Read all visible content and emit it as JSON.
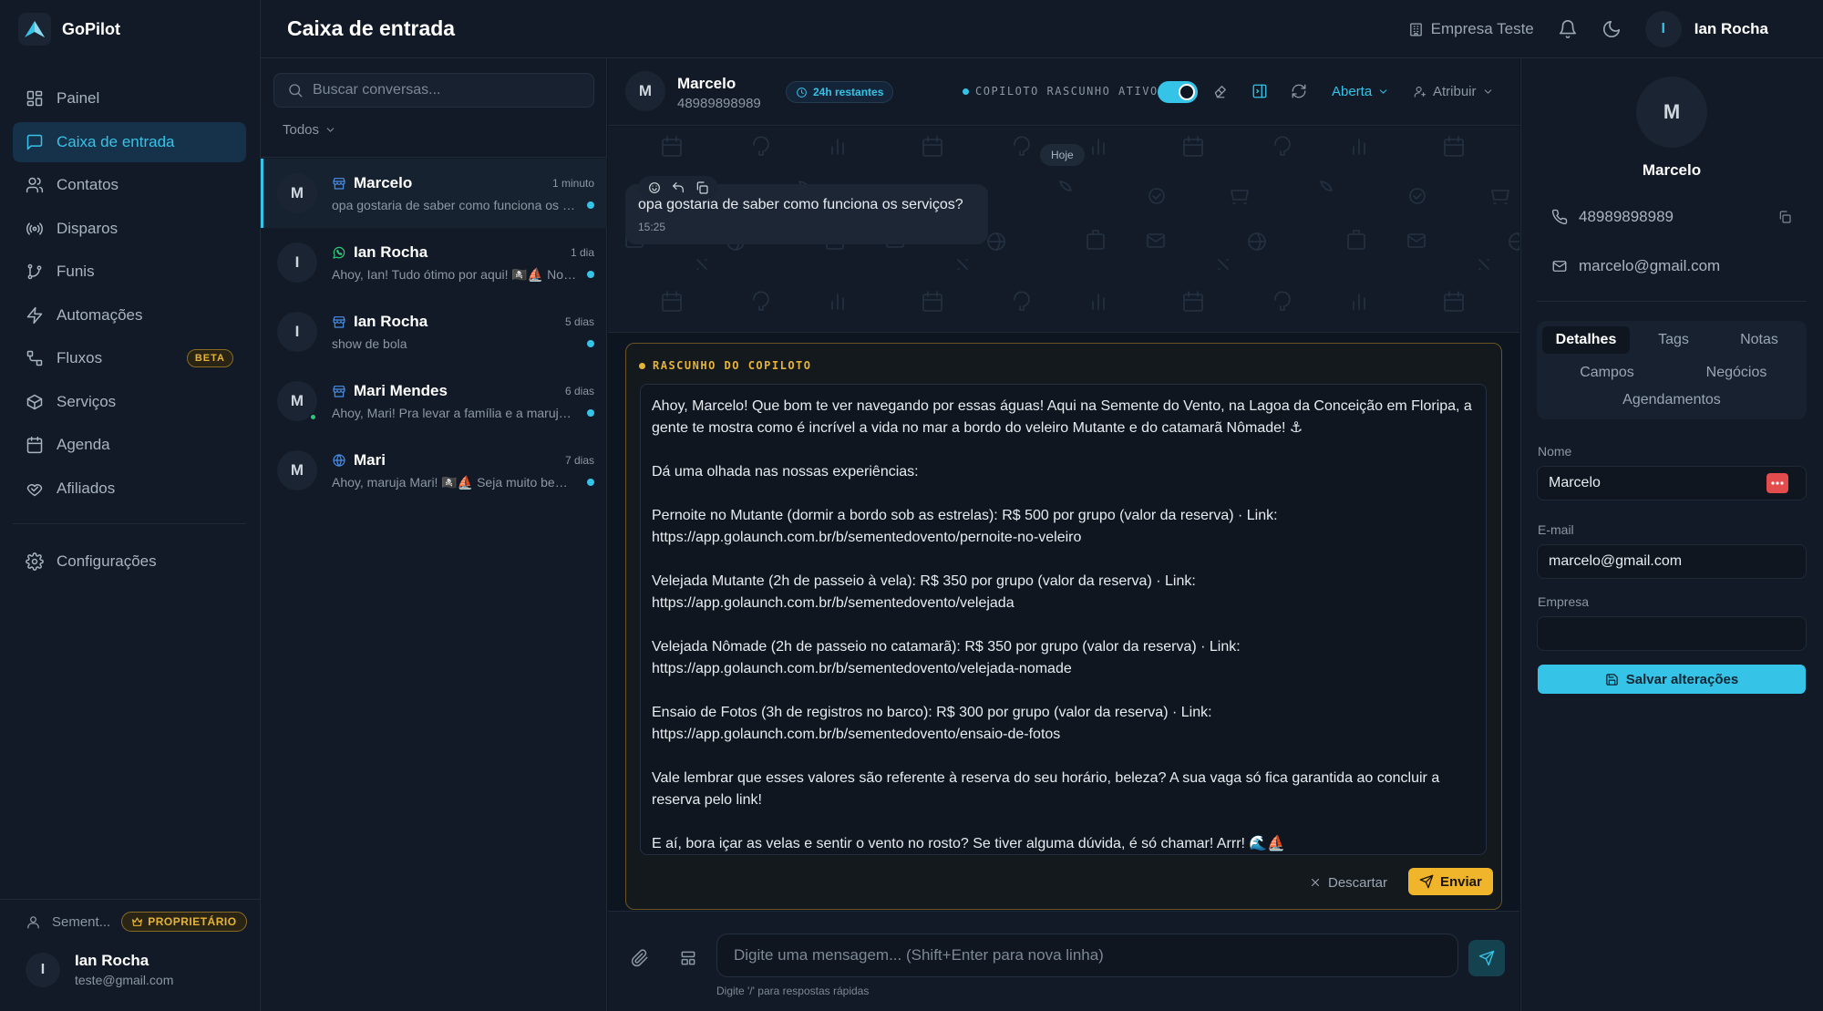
{
  "app": {
    "name": "GoPilot"
  },
  "header": {
    "title": "Caixa de entrada",
    "company": "Empresa Teste",
    "user_initial": "I",
    "user_name": "Ian Rocha"
  },
  "sidebar": {
    "items": [
      {
        "label": "Painel",
        "icon": "layout-grid-icon"
      },
      {
        "label": "Caixa de entrada",
        "icon": "message-square-icon",
        "active": true
      },
      {
        "label": "Contatos",
        "icon": "users-icon"
      },
      {
        "label": "Disparos",
        "icon": "broadcast-icon"
      },
      {
        "label": "Funis",
        "icon": "git-branch-icon"
      },
      {
        "label": "Automações",
        "icon": "zap-icon"
      },
      {
        "label": "Fluxos",
        "icon": "workflow-icon",
        "badge": "BETA"
      },
      {
        "label": "Serviços",
        "icon": "package-icon"
      },
      {
        "label": "Agenda",
        "icon": "calendar-icon"
      },
      {
        "label": "Afiliados",
        "icon": "handshake-icon"
      }
    ],
    "settings_label": "Configurações",
    "workspace": "Sement...",
    "owner_badge": "PROPRIETÁRIO",
    "user": {
      "initial": "I",
      "name": "Ian Rocha",
      "email": "teste@gmail.com"
    }
  },
  "conversations": {
    "search_placeholder": "Buscar conversas...",
    "filter": "Todos",
    "items": [
      {
        "initial": "M",
        "name": "Marcelo",
        "channel": "store-icon",
        "time": "1 minuto",
        "preview": "opa gostaria de saber como funciona os serviços?"
      },
      {
        "initial": "I",
        "name": "Ian Rocha",
        "channel": "whatsapp-icon",
        "time": "1 dia",
        "preview": "Ahoy, Ian! Tudo ótimo por aqui! 🏴‍☠️⛵ Nosso passeio"
      },
      {
        "initial": "I",
        "name": "Ian Rocha",
        "channel": "store-icon",
        "time": "5 dias",
        "preview": "show de bola"
      },
      {
        "initial": "M",
        "name": "Mari Mendes",
        "channel": "store-icon",
        "time": "6 dias",
        "preview": "Ahoy, Mari! Pra levar a família e a marujada toda"
      },
      {
        "initial": "M",
        "name": "Mari",
        "channel": "globe-icon",
        "time": "7 dias",
        "preview": "Ahoy, maruja Mari! 🏴‍☠️⛵ Seja muito bem-vinda"
      }
    ]
  },
  "chat": {
    "contact_initial": "M",
    "contact_name": "Marcelo",
    "contact_phone": "48989898989",
    "hours_left": "24h restantes",
    "copilot_label": "COPILOTO RASCUNHO ATIVO",
    "status": "Aberta",
    "assign": "Atribuir",
    "today": "Hoje",
    "message": {
      "text": "opa gostaria de saber como funciona os serviços?",
      "time": "15:25"
    },
    "draft_label": "RASCUNHO DO COPILOTO",
    "draft_text": "Ahoy, Marcelo! Que bom te ver navegando por essas águas! Aqui na Semente do Vento, na Lagoa da Conceição em Floripa, a gente te mostra como é incrível a vida no mar a bordo do veleiro Mutante e do catamarã Nômade! ⚓\n\nDá uma olhada nas nossas experiências:\n\nPernoite no Mutante (dormir a bordo sob as estrelas): R$ 500 por grupo (valor da reserva) · Link: https://app.golaunch.com.br/b/sementedovento/pernoite-no-veleiro\n\nVelejada Mutante (2h de passeio à vela): R$ 350 por grupo (valor da reserva) · Link: https://app.golaunch.com.br/b/sementedovento/velejada\n\nVelejada Nômade (2h de passeio no catamarã): R$ 350 por grupo (valor da reserva) · Link: https://app.golaunch.com.br/b/sementedovento/velejada-nomade\n\nEnsaio de Fotos (3h de registros no barco): R$ 300 por grupo (valor da reserva) · Link: https://app.golaunch.com.br/b/sementedovento/ensaio-de-fotos\n\nVale lembrar que esses valores são referente à reserva do seu horário, beleza? A sua vaga só fica garantida ao concluir a reserva pelo link!\n\nE aí, bora içar as velas e sentir o vento no rosto? Se tiver alguma dúvida, é só chamar! Arrr! 🌊⛵",
    "discard_label": "Descartar",
    "send_label": "Enviar",
    "input_placeholder": "Digite uma mensagem... (Shift+Enter para nova linha)",
    "hint": "Digite '/' para respostas rápidas"
  },
  "contact_panel": {
    "initial": "M",
    "name": "Marcelo",
    "phone": "48989898989",
    "email": "marcelo@gmail.com",
    "tabs": [
      "Detalhes",
      "Tags",
      "Notas",
      "Campos",
      "Negócios",
      "Agendamentos"
    ],
    "active_tab": "Detalhes",
    "fields": {
      "name_label": "Nome",
      "name_value": "Marcelo",
      "email_label": "E-mail",
      "email_value": "marcelo@gmail.com",
      "company_label": "Empresa",
      "company_value": ""
    },
    "save_label": "Salvar alterações"
  },
  "colors": {
    "accent": "#36c3e8",
    "amber": "#e5b338",
    "bg": "#0d1520",
    "panel": "#111a26"
  }
}
